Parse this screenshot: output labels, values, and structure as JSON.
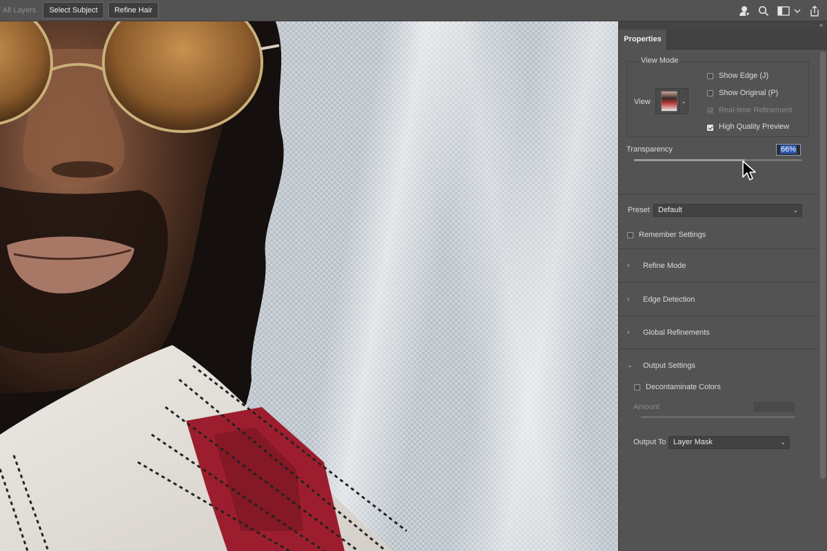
{
  "topbar": {
    "layers_label": "All Layers",
    "select_subject": "Select Subject",
    "refine_hair": "Refine Hair",
    "icons": [
      "user-add-icon",
      "search-icon",
      "panel-layout-icon",
      "chevron-down-icon",
      "share-icon"
    ]
  },
  "panel": {
    "tab": "Properties",
    "view_mode": {
      "legend": "View Mode",
      "view_label": "View",
      "show_edge": "Show Edge (J)",
      "show_original": "Show Original (P)",
      "realtime": "Real-time Refinement",
      "hq_preview": "High Quality Preview",
      "checked": {
        "show_edge": false,
        "show_original": false,
        "realtime": true,
        "hq_preview": true
      }
    },
    "transparency": {
      "label": "Transparency",
      "value": "66%",
      "level": 0.66
    },
    "preset": {
      "label": "Preset",
      "value": "Default"
    },
    "remember_settings": "Remember Settings",
    "sections": [
      {
        "title": "Refine Mode",
        "expanded": false
      },
      {
        "title": "Edge Detection",
        "expanded": false
      },
      {
        "title": "Global Refinements",
        "expanded": false
      },
      {
        "title": "Output Settings",
        "expanded": true
      }
    ],
    "output": {
      "decontaminate": "Decontaminate Colors",
      "amount_label": "Amount",
      "output_to_label": "Output To",
      "output_to_value": "Layer Mask"
    }
  },
  "colors": {
    "panel_bg": "#535353",
    "canvas_checker": "#ccd2d8",
    "accent_selection": "#2e5ab7"
  }
}
